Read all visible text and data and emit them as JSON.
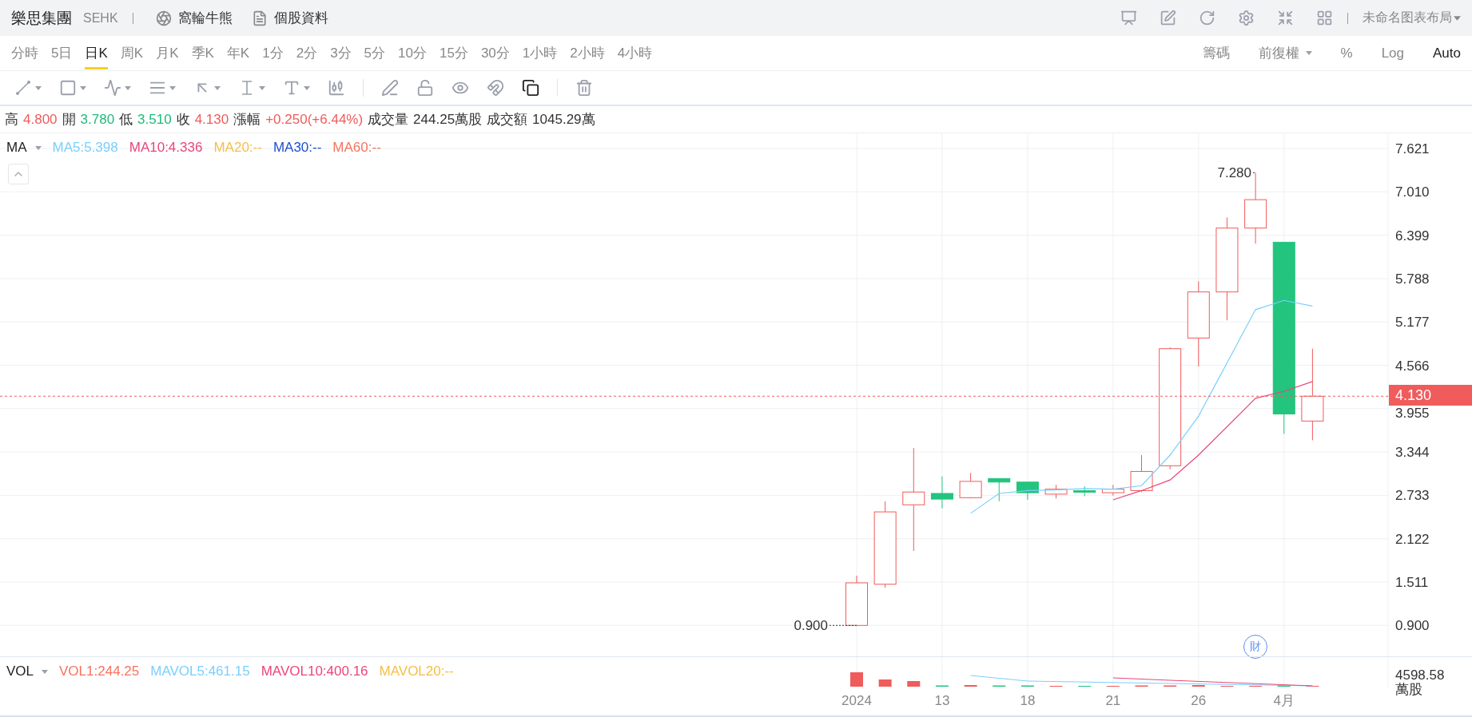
{
  "header": {
    "stock_name": "樂思集團",
    "exchange": "SEHK",
    "links": [
      {
        "label": "窩輪牛熊",
        "kind": "warrants"
      },
      {
        "label": "個股資料",
        "kind": "profile"
      }
    ],
    "layout_name": "未命名图表布局"
  },
  "periods": [
    {
      "label": "分時",
      "selected": false
    },
    {
      "label": "5日",
      "selected": false
    },
    {
      "label": "日K",
      "selected": true
    },
    {
      "label": "周K",
      "selected": false
    },
    {
      "label": "月K",
      "selected": false
    },
    {
      "label": "季K",
      "selected": false
    },
    {
      "label": "年K",
      "selected": false
    },
    {
      "label": "1分",
      "selected": false
    },
    {
      "label": "2分",
      "selected": false
    },
    {
      "label": "3分",
      "selected": false
    },
    {
      "label": "5分",
      "selected": false
    },
    {
      "label": "10分",
      "selected": false
    },
    {
      "label": "15分",
      "selected": false
    },
    {
      "label": "30分",
      "selected": false
    },
    {
      "label": "1小時",
      "selected": false
    },
    {
      "label": "2小時",
      "selected": false
    },
    {
      "label": "4小時",
      "selected": false
    }
  ],
  "chart_options": [
    {
      "label": "籌碼",
      "kind": "text",
      "selected": false
    },
    {
      "label": "前復權",
      "kind": "dropdown",
      "selected": false
    },
    {
      "label": "%",
      "kind": "text",
      "selected": false
    },
    {
      "label": "Log",
      "kind": "text",
      "selected": false
    },
    {
      "label": "Auto",
      "kind": "text",
      "selected": true
    }
  ],
  "quote": [
    {
      "label": "高",
      "value": "4.800",
      "color": "#f05b5b"
    },
    {
      "label": "開",
      "value": "3.780",
      "color": "#1fb97a"
    },
    {
      "label": "低",
      "value": "3.510",
      "color": "#1fb97a"
    },
    {
      "label": "收",
      "value": "4.130",
      "color": "#f05b5b"
    },
    {
      "label": "漲幅",
      "value": "+0.250(+6.44%)",
      "color": "#f05b5b"
    },
    {
      "label": "成交量",
      "value": "244.25萬股",
      "color": "#333333"
    },
    {
      "label": "成交額",
      "value": "1045.29萬",
      "color": "#333333"
    }
  ],
  "ma_legend": {
    "label": "MA",
    "items": [
      {
        "text": "MA5:5.398",
        "color": "#7ccffb"
      },
      {
        "text": "MA10:4.336",
        "color": "#e9467a"
      },
      {
        "text": "MA20:--",
        "color": "#f5be4a"
      },
      {
        "text": "MA30:--",
        "color": "#1f4fd0"
      },
      {
        "text": "MA60:--",
        "color": "#f5735e"
      }
    ]
  },
  "price_axis": [
    "7.621",
    "7.010",
    "6.399",
    "5.788",
    "5.177",
    "4.566",
    "3.955",
    "3.344",
    "2.733",
    "2.122",
    "1.511",
    "0.900"
  ],
  "current_price": "4.130",
  "high_marker": "7.280",
  "low_marker": "0.900",
  "event_badge": "財",
  "vol_legend": {
    "label": "VOL",
    "items": [
      {
        "text": "VOL1:244.25",
        "color": "#f5735e"
      },
      {
        "text": "MAVOL5:461.15",
        "color": "#7ccffb"
      },
      {
        "text": "MAVOL10:400.16",
        "color": "#e9467a"
      },
      {
        "text": "MAVOL20:--",
        "color": "#f5be4a"
      }
    ]
  },
  "vol_axis": {
    "max": "4598.58",
    "unit": "萬股"
  },
  "date_labels": [
    "2024",
    "13",
    "18",
    "21",
    "26",
    "4月"
  ]
}
